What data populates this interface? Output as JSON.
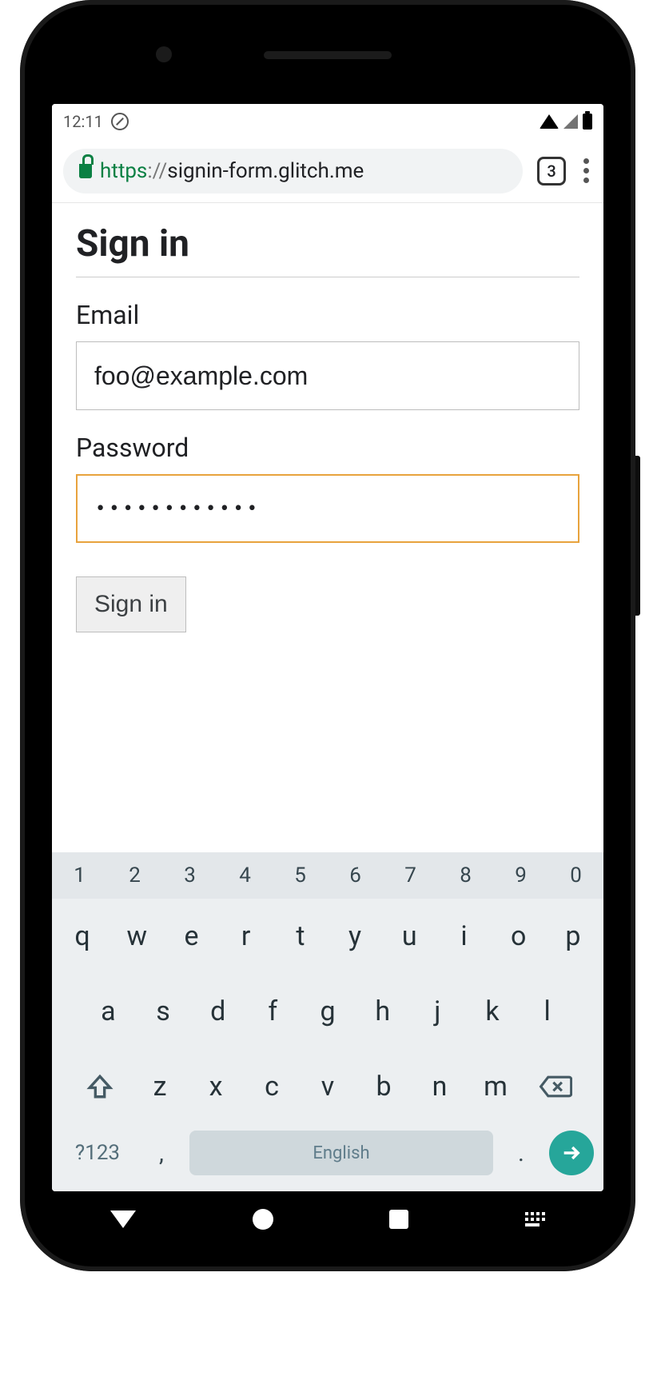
{
  "statusbar": {
    "time": "12:11"
  },
  "browser": {
    "url_scheme": "https",
    "url_sep": "://",
    "url_host": "signin-form.glitch.me",
    "tab_count": "3"
  },
  "page": {
    "title": "Sign in",
    "email_label": "Email",
    "email_value": "foo@example.com",
    "password_label": "Password",
    "password_value": "••••••••••••",
    "submit_label": "Sign in"
  },
  "keyboard": {
    "numbers": [
      "1",
      "2",
      "3",
      "4",
      "5",
      "6",
      "7",
      "8",
      "9",
      "0"
    ],
    "row1": [
      "q",
      "w",
      "e",
      "r",
      "t",
      "y",
      "u",
      "i",
      "o",
      "p"
    ],
    "row2": [
      "a",
      "s",
      "d",
      "f",
      "g",
      "h",
      "j",
      "k",
      "l"
    ],
    "row3": [
      "z",
      "x",
      "c",
      "v",
      "b",
      "n",
      "m"
    ],
    "symbols_label": "?123",
    "comma": ",",
    "period": ".",
    "space_label": "English"
  }
}
